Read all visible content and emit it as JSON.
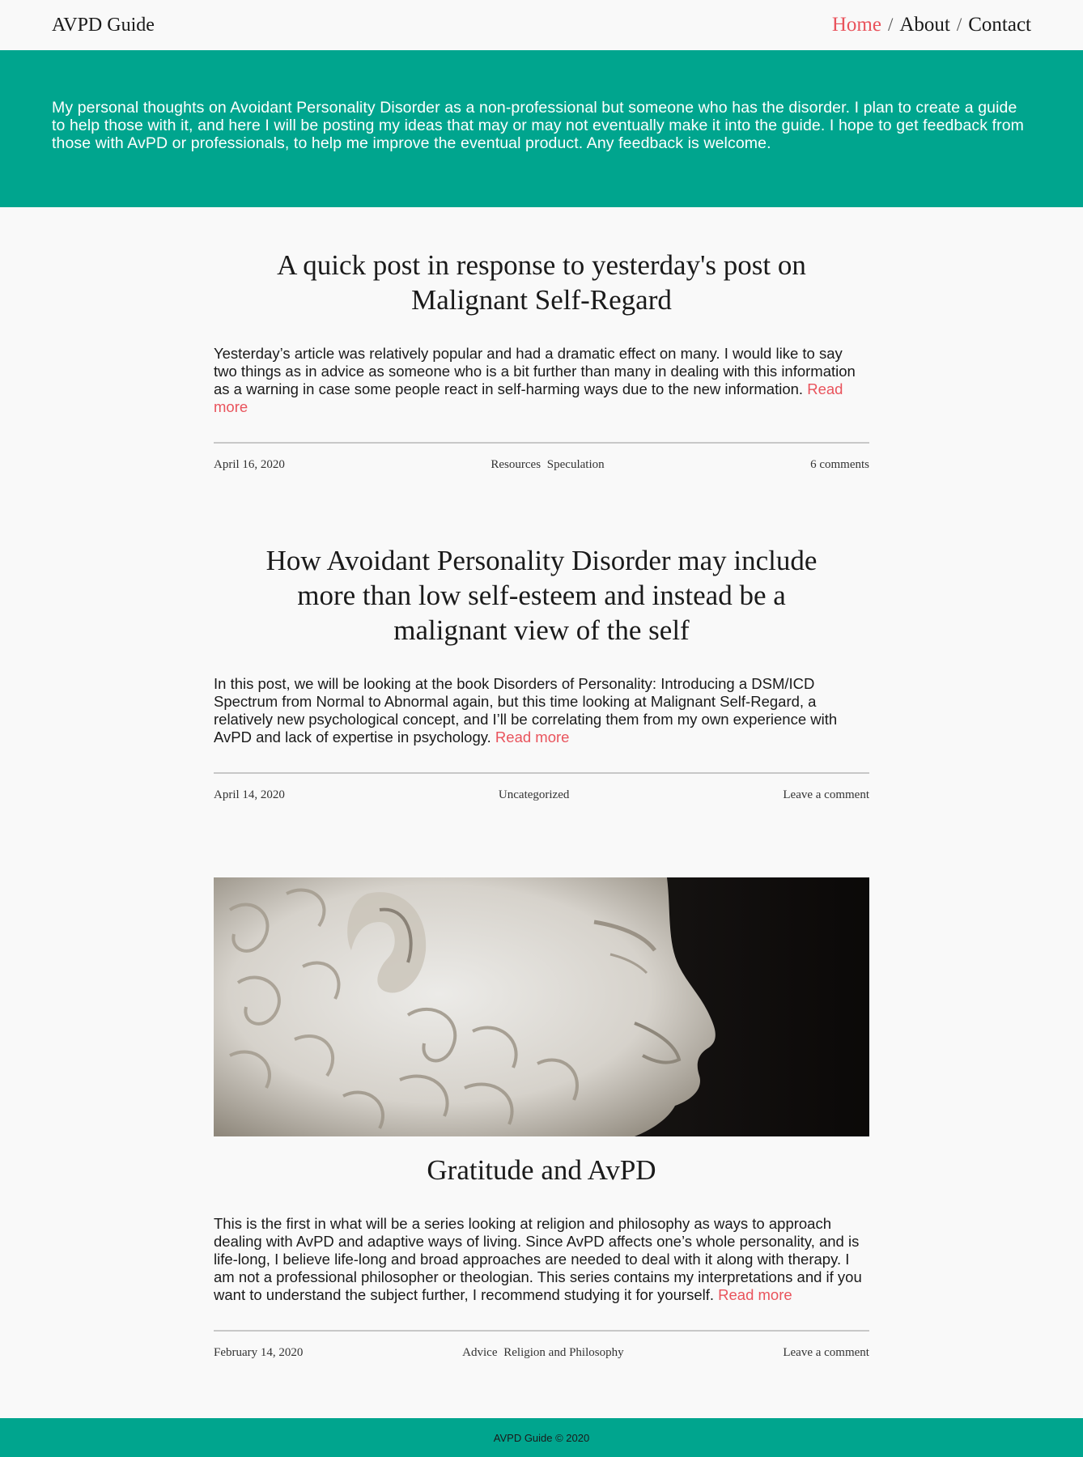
{
  "header": {
    "site_title": "AVPD Guide",
    "nav": [
      {
        "label": "Home",
        "active": true
      },
      {
        "label": "About",
        "active": false
      },
      {
        "label": "Contact",
        "active": false
      }
    ],
    "nav_separator": "/"
  },
  "hero": {
    "description": "My personal thoughts on Avoidant Personality Disorder as a non-professional but someone who has the disorder. I plan to create a guide to help those with it, and here I will be posting my ideas that may or may not eventually make it into the guide. I hope to get feedback from those with AvPD or professionals, to help me improve the eventual product. Any feedback is welcome."
  },
  "posts": [
    {
      "title": "A quick post in response to yesterday's post on Malignant Self-Regard",
      "excerpt": "Yesterday’s article was relatively popular and had a dramatic effect on many. I would like to say two things as in advice as someone who is a bit further than many in dealing with this information as a warning in case some people react in self-harming ways due to the new information.",
      "read_more": "Read more",
      "date": "April 16, 2020",
      "categories": [
        "Resources",
        "Speculation"
      ],
      "comments": "6 comments"
    },
    {
      "title": "How Avoidant Personality Disorder may include more than low self-esteem and instead be a malignant view of the self",
      "excerpt": "In this post, we will be looking at the book Disorders of Personality: Introducing a DSM/ICD Spectrum from Normal to Abnormal again, but this time looking at Malignant Self-Regard, a relatively new psychological concept, and I’ll be correlating them from my own experience with AvPD and lack of expertise in psychology.",
      "read_more": "Read more",
      "date": "April 14, 2020",
      "categories": [
        "Uncategorized"
      ],
      "comments": "Leave a comment"
    },
    {
      "title": "Gratitude and AvPD",
      "excerpt": "This is the first in what will be a series looking at religion and philosophy as ways to approach dealing with AvPD and adaptive ways of living. Since AvPD affects one’s whole personality, and is life-long, I believe life-long and broad approaches are needed to deal with it along with therapy. I am not a professional philosopher or theologian. This series contains my interpretations and if you want to understand the subject further, I recommend studying it for yourself.",
      "read_more": "Read more",
      "date": "February 14, 2020",
      "categories": [
        "Advice",
        "Religion and Philosophy"
      ],
      "comments": "Leave a comment",
      "image": "marble-bust-profile"
    }
  ],
  "footer": {
    "text": "AVPD Guide © 2020"
  },
  "colors": {
    "accent": "#00a58e",
    "link": "#e9535c",
    "background": "#f9f9f9"
  }
}
